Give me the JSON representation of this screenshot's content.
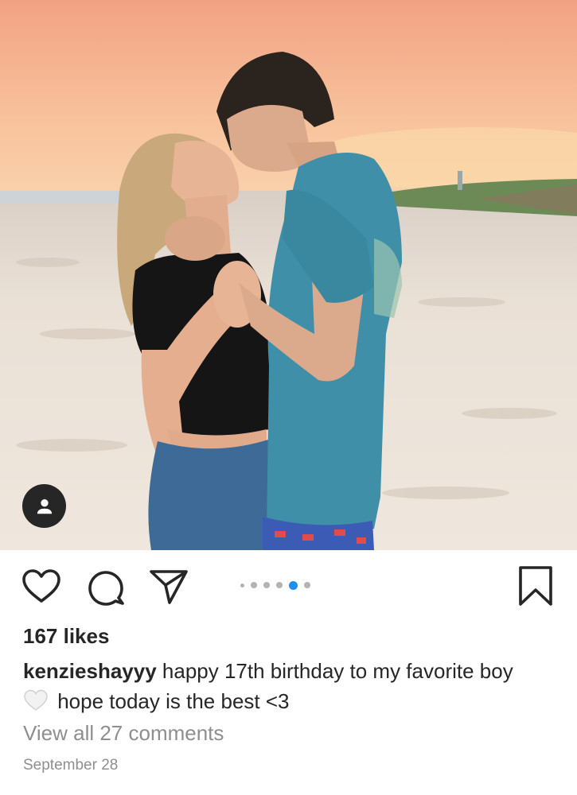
{
  "post": {
    "photo": {
      "description_icon": "beach-sunset-couple-photo",
      "colors": {
        "sky_top": "#f3a985",
        "sky_horizon": "#f9cfa6",
        "sand": "#ece3d8",
        "shirt": "#3f8fa8",
        "top": "#151515",
        "denim": "#3e6a98"
      }
    },
    "tag_icon": "person-icon",
    "actions": {
      "like_icon": "heart-outline-icon",
      "comment_icon": "comment-bubble-icon",
      "share_icon": "paper-plane-icon",
      "save_icon": "bookmark-icon"
    },
    "carousel": {
      "count": 6,
      "active_index": 4,
      "accent": "#1e8ef0"
    },
    "likes_text": "167 likes",
    "caption": {
      "username": "kenzieshayyy",
      "text_line1": " happy 17th birthday to my favorite boy",
      "emoji": "white-heart-emoji",
      "text_line2": " hope today is the best <3"
    },
    "comments_link": "View all 27 comments",
    "date": "September 28"
  }
}
